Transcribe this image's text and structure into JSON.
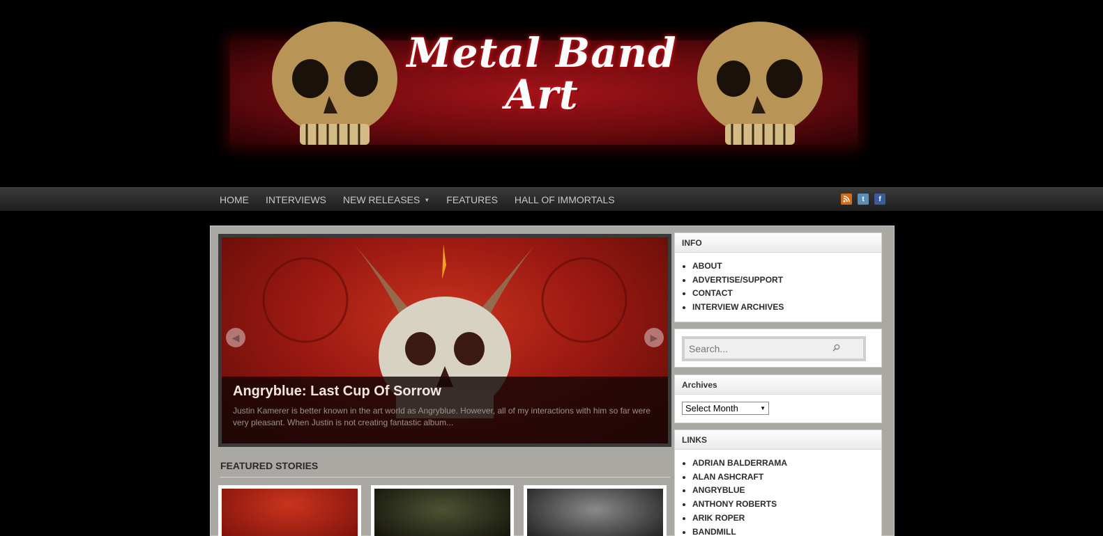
{
  "banner": {
    "title": "Metal Band Art"
  },
  "nav": {
    "items": [
      {
        "label": "HOME"
      },
      {
        "label": "INTERVIEWS"
      },
      {
        "label": "NEW RELEASES"
      },
      {
        "label": "FEATURES"
      },
      {
        "label": "HALL OF IMMORTALS"
      }
    ],
    "social": [
      "rss-icon",
      "twitter-icon",
      "facebook-icon"
    ]
  },
  "slider": {
    "title": "Angryblue: Last Cup Of Sorrow",
    "excerpt": "Justin Kamerer is better known in the art world as Angryblue.  However, all of my interactions with him so far were very pleasant.  When Justin is not creating fantastic album..."
  },
  "featured": {
    "title": "FEATURED STORIES"
  },
  "sidebar": {
    "info": {
      "title": "INFO",
      "items": [
        "ABOUT",
        "ADVERTISE/SUPPORT",
        "CONTACT",
        "INTERVIEW ARCHIVES"
      ]
    },
    "search": {
      "placeholder": "Search..."
    },
    "archives": {
      "title": "Archives",
      "selected": "Select Month"
    },
    "links": {
      "title": "LINKS",
      "items": [
        "ADRIAN BALDERRAMA",
        "ALAN ASHCRAFT",
        "ANGRYBLUE",
        "ANTHONY ROBERTS",
        "ARIK ROPER",
        "BANDMILL"
      ]
    }
  },
  "colors": {
    "nav_bg": "#2a2a2a",
    "content_bg": "#a9a8a3",
    "banner_red": "#9d1a12"
  }
}
